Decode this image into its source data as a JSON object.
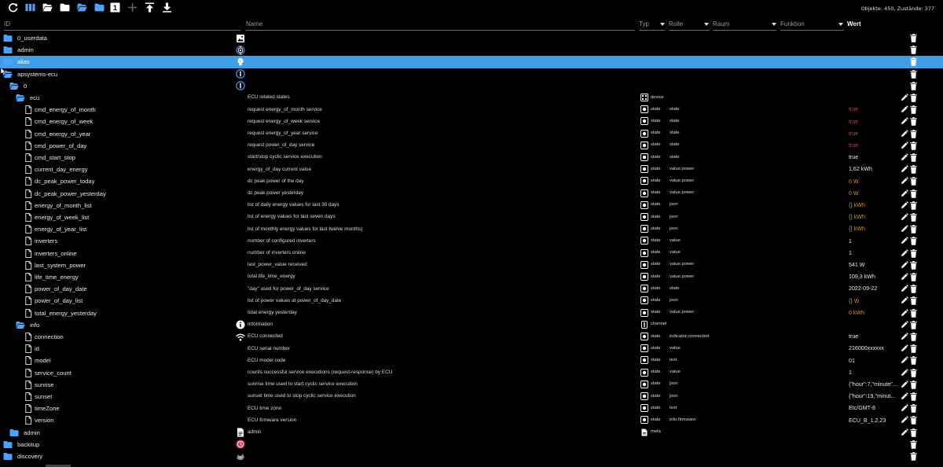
{
  "toolbar": {
    "buttons": [
      {
        "name": "refresh-button",
        "icon": "refresh-icon",
        "color": "#ffffff"
      },
      {
        "name": "columns-button",
        "icon": "columns-icon",
        "color": "#4aa3ff"
      },
      {
        "name": "collapse-all-button",
        "icon": "folder-open-icon",
        "color": "#ffffff"
      },
      {
        "name": "expand-all-button",
        "icon": "folder-icon",
        "color": "#ffffff"
      },
      {
        "name": "collapse-level-button",
        "icon": "folder-open-icon",
        "color": "#4aa3ff"
      },
      {
        "name": "expand-level-button",
        "icon": "folder-icon",
        "color": "#4aa3ff"
      },
      {
        "name": "level-one-button",
        "icon": "box-one-icon",
        "color": "#ffffff",
        "text": "1"
      },
      {
        "name": "add-button",
        "icon": "plus-icon",
        "color": "#666666"
      },
      {
        "name": "upload-button",
        "icon": "upload-icon",
        "color": "#ffffff"
      },
      {
        "name": "download-button",
        "icon": "download-icon",
        "color": "#ffffff"
      }
    ],
    "counts": "Objekte: 450, Zustände: 377"
  },
  "header": {
    "id": "ID",
    "name": "Name",
    "typ": "Typ",
    "rolle": "Rolle",
    "raum": "Raum",
    "funktion": "Funktion",
    "wert": "Wert"
  },
  "rows": [
    {
      "id": "0_userdata",
      "depth": 0,
      "kind": "folder-closed",
      "icon": "image-icon",
      "name": "",
      "typ": "",
      "role": "",
      "value": "",
      "valueColor": "",
      "edit": false,
      "selected": false
    },
    {
      "id": "admin",
      "depth": 0,
      "kind": "folder-closed",
      "icon": "admin-gear-icon",
      "name": "",
      "typ": "",
      "role": "",
      "value": "",
      "valueColor": "",
      "edit": false,
      "selected": false
    },
    {
      "id": "alias",
      "depth": 0,
      "kind": "folder-closed",
      "icon": "lightbulb-icon",
      "name": "",
      "typ": "",
      "role": "",
      "value": "",
      "valueColor": "",
      "edit": false,
      "selected": true
    },
    {
      "id": "apsystems-ecu",
      "depth": 0,
      "kind": "folder-open",
      "icon": "info-circle-icon",
      "name": "",
      "typ": "",
      "role": "",
      "value": "",
      "valueColor": "",
      "edit": false,
      "selected": false
    },
    {
      "id": "0",
      "depth": 1,
      "kind": "folder-open",
      "icon": "info-circle-icon",
      "name": "",
      "typ": "",
      "role": "",
      "value": "",
      "valueColor": "",
      "edit": false,
      "selected": false
    },
    {
      "id": "ecu",
      "depth": 2,
      "kind": "folder-open",
      "icon": "",
      "name": "ECU related states",
      "typ": "device",
      "typIcon": "device-icon",
      "role": "",
      "value": "",
      "valueColor": "",
      "edit": true,
      "selected": false
    },
    {
      "id": "cmd_energy_of_month",
      "depth": 3,
      "kind": "file",
      "icon": "",
      "name": "request energy_of_month service",
      "typ": "state",
      "typIcon": "state-icon",
      "role": "state",
      "value": "true",
      "valueColor": "red",
      "edit": true,
      "selected": false
    },
    {
      "id": "cmd_energy_of_week",
      "depth": 3,
      "kind": "file",
      "icon": "",
      "name": "request energy_of_week service",
      "typ": "state",
      "typIcon": "state-icon",
      "role": "state",
      "value": "true",
      "valueColor": "red",
      "edit": true,
      "selected": false
    },
    {
      "id": "cmd_energy_of_year",
      "depth": 3,
      "kind": "file",
      "icon": "",
      "name": "request energy_of_year service",
      "typ": "state",
      "typIcon": "state-icon",
      "role": "state",
      "value": "true",
      "valueColor": "red",
      "edit": true,
      "selected": false
    },
    {
      "id": "cmd_power_of_day",
      "depth": 3,
      "kind": "file",
      "icon": "",
      "name": "request power_of_day service",
      "typ": "state",
      "typIcon": "state-icon",
      "role": "state",
      "value": "true",
      "valueColor": "red",
      "edit": true,
      "selected": false
    },
    {
      "id": "cmd_start_stop",
      "depth": 3,
      "kind": "file",
      "icon": "",
      "name": "start/stop cyclic service execution",
      "typ": "state",
      "typIcon": "state-icon",
      "role": "state",
      "value": "true",
      "valueColor": "",
      "edit": true,
      "selected": false
    },
    {
      "id": "current_day_energy",
      "depth": 3,
      "kind": "file",
      "icon": "",
      "name": "energy_of_day current value",
      "typ": "state",
      "typIcon": "state-icon",
      "role": "value.power",
      "value": "1,62 kWh",
      "valueColor": "",
      "edit": true,
      "selected": false
    },
    {
      "id": "dc_peak_power_today",
      "depth": 3,
      "kind": "file",
      "icon": "",
      "name": "dc peak power of the day",
      "typ": "state",
      "typIcon": "state-icon",
      "role": "value.power",
      "value": "0 W",
      "valueColor": "orange",
      "edit": true,
      "selected": false
    },
    {
      "id": "dc_peak_power_yesterday",
      "depth": 3,
      "kind": "file",
      "icon": "",
      "name": "dc peak power yesterday",
      "typ": "state",
      "typIcon": "state-icon",
      "role": "value.power",
      "value": "0 W",
      "valueColor": "orange",
      "edit": true,
      "selected": false
    },
    {
      "id": "energy_of_month_list",
      "depth": 3,
      "kind": "file",
      "icon": "",
      "name": "list of daily energy values for last 30 days",
      "typ": "state",
      "typIcon": "state-icon",
      "role": "json",
      "value": "{} kWh",
      "valueColor": "orange",
      "edit": true,
      "selected": false
    },
    {
      "id": "energy_of_week_list",
      "depth": 3,
      "kind": "file",
      "icon": "",
      "name": "list of energy values for last seven days",
      "typ": "state",
      "typIcon": "state-icon",
      "role": "json",
      "value": "{} kWh",
      "valueColor": "orange",
      "edit": true,
      "selected": false
    },
    {
      "id": "energy_of_year_list",
      "depth": 3,
      "kind": "file",
      "icon": "",
      "name": "list of monthly energy values for last twelve months)",
      "typ": "state",
      "typIcon": "state-icon",
      "role": "json",
      "value": "{} kWh",
      "valueColor": "orange",
      "edit": true,
      "selected": false
    },
    {
      "id": "inverters",
      "depth": 3,
      "kind": "file",
      "icon": "",
      "name": "number of configured inverters",
      "typ": "state",
      "typIcon": "state-icon",
      "role": "value",
      "value": "1",
      "valueColor": "",
      "edit": true,
      "selected": false
    },
    {
      "id": "inverters_online",
      "depth": 3,
      "kind": "file",
      "icon": "",
      "name": "number of inverters online",
      "typ": "state",
      "typIcon": "state-icon",
      "role": "value",
      "value": "1",
      "valueColor": "",
      "edit": true,
      "selected": false
    },
    {
      "id": "last_system_power",
      "depth": 3,
      "kind": "file",
      "icon": "",
      "name": "last_power_value received",
      "typ": "state",
      "typIcon": "state-icon",
      "role": "value.power",
      "value": "541 W",
      "valueColor": "",
      "edit": true,
      "selected": false
    },
    {
      "id": "life_time_energy",
      "depth": 3,
      "kind": "file",
      "icon": "",
      "name": "total life_time_energy",
      "typ": "state",
      "typIcon": "state-icon",
      "role": "value.power",
      "value": "109,3 kWh",
      "valueColor": "",
      "edit": true,
      "selected": false
    },
    {
      "id": "power_of_day_date",
      "depth": 3,
      "kind": "file",
      "icon": "",
      "name": "\"day\" used for power_of_day service",
      "typ": "state",
      "typIcon": "state-icon",
      "role": "state",
      "value": "2022-09-22",
      "valueColor": "",
      "edit": true,
      "selected": false
    },
    {
      "id": "power_of_day_list",
      "depth": 3,
      "kind": "file",
      "icon": "",
      "name": "list of power values at power_of_day_date",
      "typ": "state",
      "typIcon": "state-icon",
      "role": "json",
      "value": "{} W",
      "valueColor": "orange",
      "edit": true,
      "selected": false
    },
    {
      "id": "total_energy_yesterday",
      "depth": 3,
      "kind": "file",
      "icon": "",
      "name": "total energy yesterday",
      "typ": "state",
      "typIcon": "state-icon",
      "role": "value.power",
      "value": "0 kWh",
      "valueColor": "orange",
      "edit": true,
      "selected": false
    },
    {
      "id": "info",
      "depth": 2,
      "kind": "folder-open",
      "icon": "info-solid-icon",
      "name": "Information",
      "typ": "channel",
      "typIcon": "channel-icon",
      "role": "",
      "value": "",
      "valueColor": "",
      "edit": true,
      "selected": false
    },
    {
      "id": "connection",
      "depth": 3,
      "kind": "file",
      "icon": "wifi-icon",
      "name": "ECU connected",
      "typ": "state",
      "typIcon": "state-icon",
      "role": "indicator.connected",
      "value": "true",
      "valueColor": "",
      "edit": true,
      "selected": false
    },
    {
      "id": "id",
      "depth": 3,
      "kind": "file",
      "icon": "",
      "name": "ECU serial number",
      "typ": "state",
      "typIcon": "state-icon",
      "role": "value",
      "value": "216000xxxxxx",
      "valueColor": "",
      "edit": true,
      "selected": false
    },
    {
      "id": "model",
      "depth": 3,
      "kind": "file",
      "icon": "",
      "name": "ECU model code",
      "typ": "state",
      "typIcon": "state-icon",
      "role": "text",
      "value": "01",
      "valueColor": "",
      "edit": true,
      "selected": false
    },
    {
      "id": "service_count",
      "depth": 3,
      "kind": "file",
      "icon": "",
      "name": "counts successful service executions (request-response) by ECU",
      "typ": "state",
      "typIcon": "state-icon",
      "role": "value",
      "value": "1",
      "valueColor": "",
      "edit": true,
      "selected": false
    },
    {
      "id": "sunrise",
      "depth": 3,
      "kind": "file",
      "icon": "",
      "name": "sunrise time used to start cyclic service execution",
      "typ": "state",
      "typIcon": "state-icon",
      "role": "json",
      "value": "{\"hour\":7,\"minute\"...",
      "valueColor": "",
      "edit": true,
      "selected": false
    },
    {
      "id": "sunset",
      "depth": 3,
      "kind": "file",
      "icon": "",
      "name": "sunset time used to stop cyclic service execution",
      "typ": "state",
      "typIcon": "state-icon",
      "role": "json",
      "value": "{\"hour\":19,\"minut...",
      "valueColor": "",
      "edit": true,
      "selected": false
    },
    {
      "id": "timeZone",
      "depth": 3,
      "kind": "file",
      "icon": "",
      "name": "ECU time zone",
      "typ": "state",
      "typIcon": "state-icon",
      "role": "text",
      "value": "Etc/GMT-8",
      "valueColor": "",
      "edit": true,
      "selected": false
    },
    {
      "id": "version",
      "depth": 3,
      "kind": "file",
      "icon": "",
      "name": "ECU firmware version",
      "typ": "state",
      "typIcon": "state-icon",
      "role": "info.firmware",
      "value": "ECU_B_1.2.23",
      "valueColor": "",
      "edit": true,
      "selected": false
    },
    {
      "id": "admin",
      "depth": 1,
      "kind": "folder-closed",
      "icon": "document-icon",
      "name": "admin",
      "typ": "meta",
      "typIcon": "meta-icon",
      "role": "",
      "value": "",
      "valueColor": "",
      "edit": true,
      "selected": false
    },
    {
      "id": "backitup",
      "depth": 0,
      "kind": "folder-closed",
      "icon": "backitup-icon",
      "name": "",
      "typ": "",
      "role": "",
      "value": "",
      "valueColor": "",
      "edit": false,
      "selected": false
    },
    {
      "id": "discovery",
      "depth": 0,
      "kind": "folder-closed",
      "icon": "discovery-icon",
      "name": "",
      "typ": "",
      "role": "",
      "value": "",
      "valueColor": "",
      "edit": false,
      "selected": false
    }
  ],
  "colors": {
    "folder": "#4aa3ff",
    "selected": "#3f9ee6",
    "valueRed": "#d7412f",
    "valueOrange": "#e0920d",
    "background": "#000000"
  }
}
